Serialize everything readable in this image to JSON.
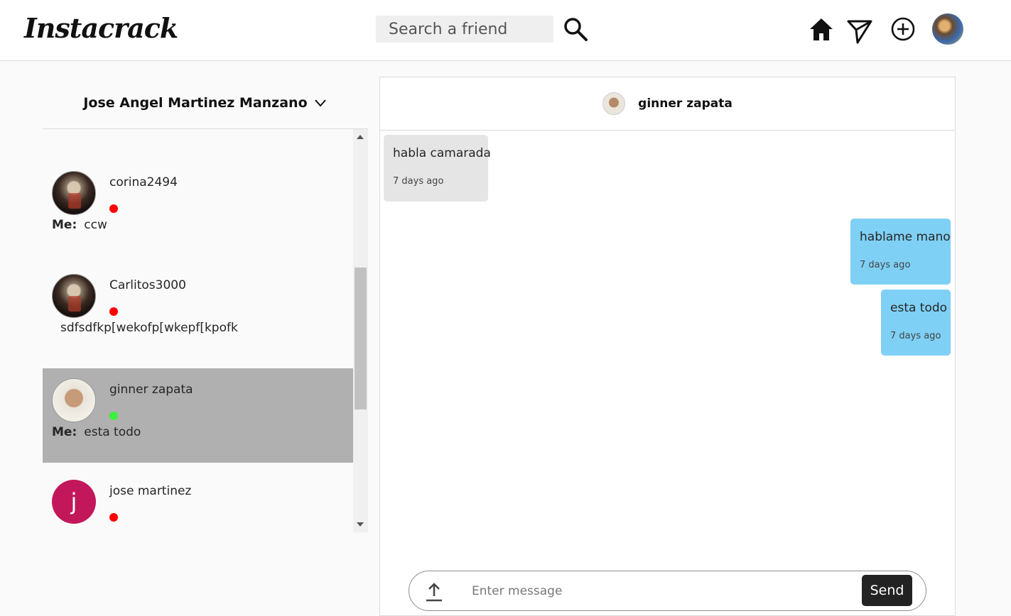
{
  "app": {
    "logo": "Instacrack"
  },
  "search": {
    "placeholder": "Search a friend"
  },
  "account": {
    "name": "Jose Angel Martinez Manzano"
  },
  "conversations": [
    {
      "name": "corina2494",
      "status": "offline",
      "me_label": "Me:",
      "last": "ccw"
    },
    {
      "name": "Carlitos3000",
      "status": "offline",
      "me_label": "",
      "last": "sdfsdfkp[wekofp[wkepf[kpofk"
    },
    {
      "name": "ginner zapata",
      "status": "online",
      "me_label": "Me:",
      "last": "esta todo",
      "active": true
    },
    {
      "name": "jose martinez",
      "status": "offline",
      "avatar_letter": "j",
      "me_label": "",
      "last": ""
    }
  ],
  "chat": {
    "partner": "ginner zapata",
    "messages": [
      {
        "from": "them",
        "text": "habla camarada",
        "time": "7 days ago"
      },
      {
        "from": "me",
        "text": "hablame mano",
        "time": "7 days ago"
      },
      {
        "from": "me",
        "text": "esta todo",
        "time": "7 days ago"
      }
    ],
    "input_placeholder": "Enter message",
    "send_label": "Send"
  },
  "colors": {
    "incoming": "#e5e5e5",
    "outgoing": "#7fd0f5",
    "online": "#3cf03c",
    "offline": "#ff0000",
    "active_row": "#b0b0b0"
  }
}
